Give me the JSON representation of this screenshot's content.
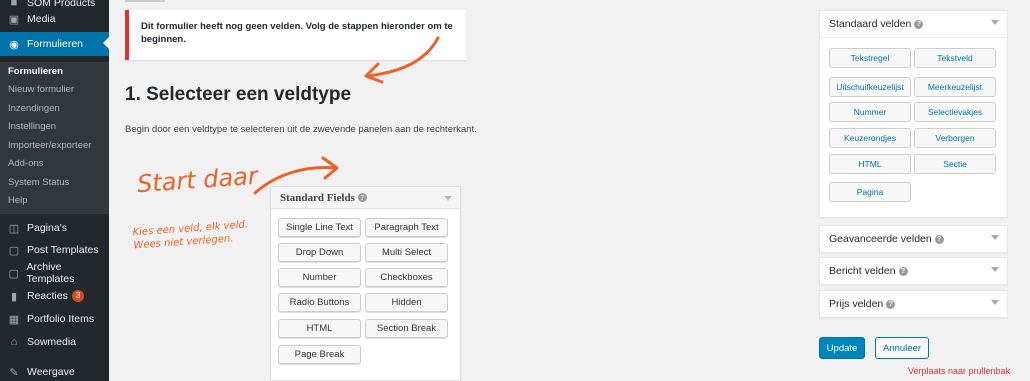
{
  "sidebar": {
    "top_item": {
      "label": "SOM Products",
      "icon": "products-icon"
    },
    "media": {
      "label": "Media",
      "icon": "media-icon"
    },
    "formulieren": {
      "label": "Formulieren",
      "icon": "forms-icon"
    },
    "submenu": [
      "Formulieren",
      "Nieuw formulier",
      "Inzendingen",
      "Instellingen",
      "Importeer/exporteer",
      "Add-ons",
      "System Status",
      "Help"
    ],
    "items": [
      {
        "label": "Pagina's",
        "icon": "pages-icon"
      },
      {
        "label": "Post Templates",
        "icon": "page-icon"
      },
      {
        "label": "Archive Templates",
        "icon": "page-icon"
      },
      {
        "label": "Reacties",
        "icon": "comments-icon",
        "badge": "3"
      },
      {
        "label": "Portfolio Items",
        "icon": "portfolio-icon"
      },
      {
        "label": "Sowmedia",
        "icon": "home-icon"
      },
      {
        "label": "Weergave",
        "icon": "brush-icon"
      }
    ]
  },
  "notice": {
    "text": "Dit formulier heeft nog geen velden. Volg de stappen hieronder om te beginnen."
  },
  "step_title": "1. Selecteer een veldtype",
  "intro_text": "Begin door een veldtype te selecteren uit de zwevende panelen aan de rechterkant.",
  "handwritten": {
    "start": "Start daar",
    "hint": "Kies een veld, elk veld. Wees niet verlegen."
  },
  "example_panel": {
    "title": "Standard Fields",
    "buttons": [
      "Single Line Text",
      "Paragraph Text",
      "Drop Down",
      "Multi Select",
      "Number",
      "Checkboxes",
      "Radio Buttons",
      "Hidden",
      "HTML",
      "Section Break",
      "Page Break"
    ]
  },
  "standard_fields": {
    "title": "Standaard velden",
    "buttons": [
      "Tekstregel",
      "Tekstveld",
      "Uitschuifkeuzelijst",
      "Meerkeuzelijst",
      "Nummer",
      "Selectievakjes",
      "Keuzerondjes",
      "Verborgen",
      "HTML",
      "Sectie",
      "Pagina"
    ]
  },
  "collapsed_panels": [
    "Geavanceerde velden",
    "Bericht velden",
    "Prijs velden"
  ],
  "actions": {
    "update": "Update",
    "cancel": "Annuleer",
    "trash": "Verplaats naar prullenbak"
  },
  "colors": {
    "sidebar": "#23282d",
    "active": "#0073aa",
    "accent_orange": "#e8622a",
    "error": "#dc3232"
  }
}
